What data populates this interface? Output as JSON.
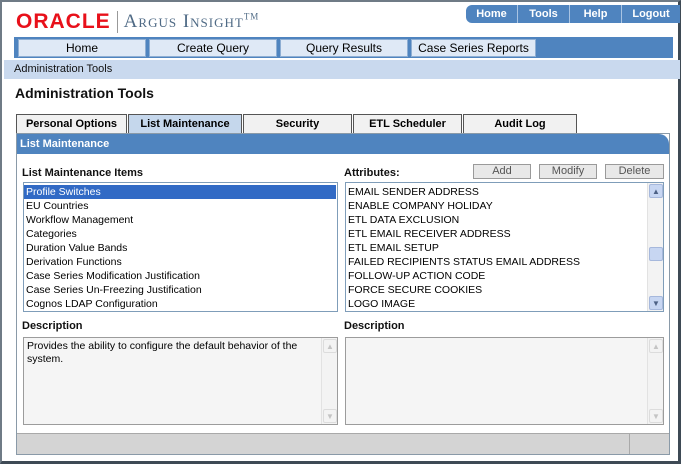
{
  "header": {
    "brand": "ORACLE",
    "product": "Argus Insight",
    "trademark": "TM",
    "top_nav": [
      "Home",
      "Tools",
      "Help",
      "Logout"
    ]
  },
  "main_nav": [
    "Home",
    "Create Query",
    "Query Results",
    "Case Series Reports"
  ],
  "breadcrumb": "Administration Tools",
  "page_title": "Administration Tools",
  "tabs": [
    {
      "label": "Personal Options",
      "active": false
    },
    {
      "label": "List Maintenance",
      "active": true
    },
    {
      "label": "Security",
      "active": false
    },
    {
      "label": "ETL Scheduler",
      "active": false
    },
    {
      "label": "Audit Log",
      "active": false
    }
  ],
  "panel": {
    "title": "List Maintenance",
    "items_label": "List Maintenance Items",
    "items": [
      "Profile Switches",
      "EU Countries",
      "Workflow Management",
      "Categories",
      "Duration Value Bands",
      "Derivation Functions",
      "Case Series Modification Justification",
      "Case Series Un-Freezing Justification",
      "Cognos LDAP Configuration"
    ],
    "selected_item": "Profile Switches",
    "attributes_label": "Attributes:",
    "buttons": {
      "add": "Add",
      "modify": "Modify",
      "delete": "Delete"
    },
    "attributes": [
      "EMAIL SENDER ADDRESS",
      "ENABLE COMPANY HOLIDAY",
      "ETL DATA EXCLUSION",
      "ETL EMAIL RECEIVER ADDRESS",
      "ETL EMAIL SETUP",
      "FAILED RECIPIENTS STATUS EMAIL ADDRESS",
      "FOLLOW-UP ACTION CODE",
      "FORCE SECURE COOKIES",
      "LOGO IMAGE"
    ],
    "description_label_left": "Description",
    "description_label_right": "Description",
    "description_left": "Provides the ability to configure the default behavior of the system.",
    "description_right": ""
  }
}
